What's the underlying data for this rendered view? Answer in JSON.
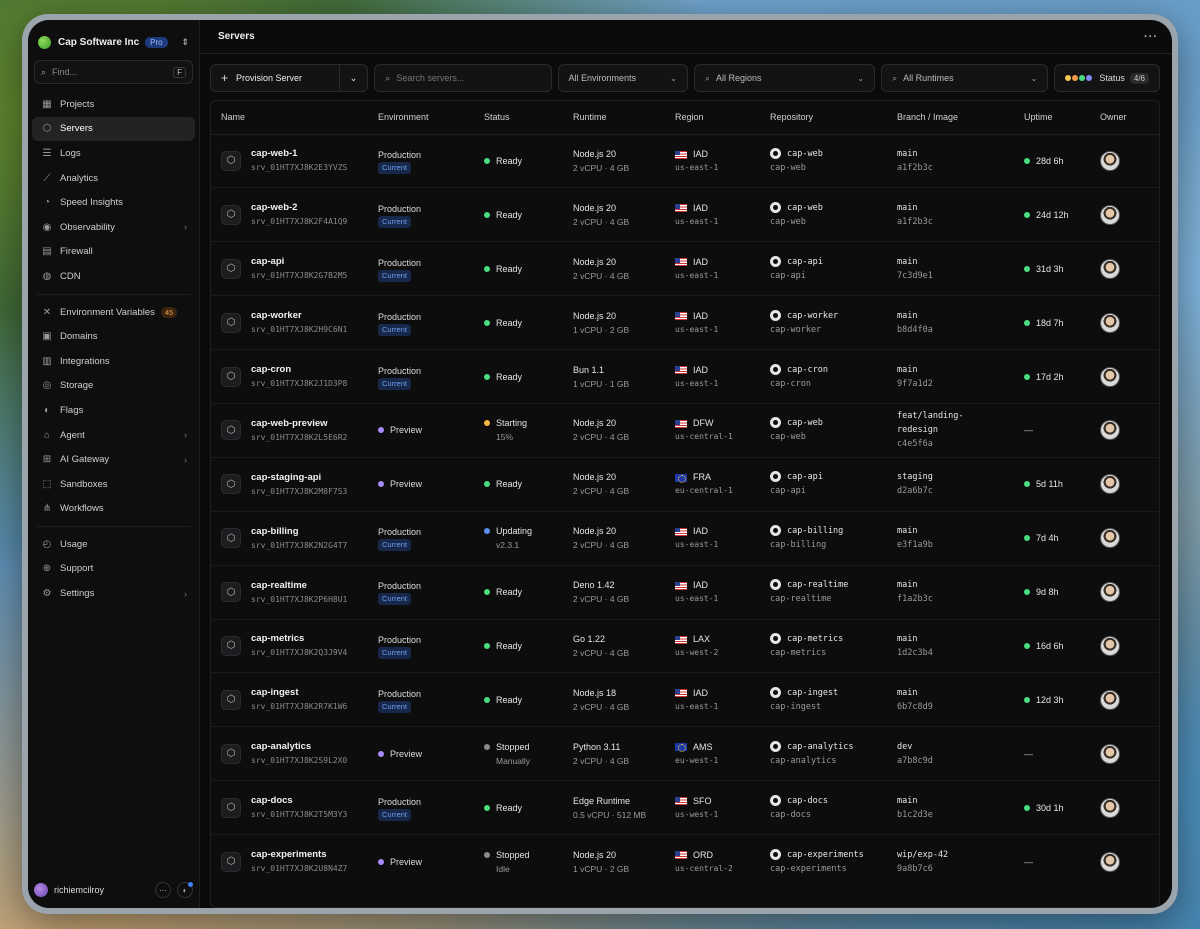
{
  "team": {
    "name": "Cap Software Inc",
    "plan": "Pro"
  },
  "find": {
    "placeholder": "Find...",
    "shortcut": "F"
  },
  "nav": {
    "group1": [
      {
        "label": "Projects",
        "icon": "grid-icon"
      },
      {
        "label": "Servers",
        "icon": "cube-icon",
        "active": true
      },
      {
        "label": "Logs",
        "icon": "list-icon"
      },
      {
        "label": "Analytics",
        "icon": "chart-icon"
      },
      {
        "label": "Speed Insights",
        "icon": "gauge-icon"
      },
      {
        "label": "Observability",
        "icon": "eye-icon",
        "chevron": true
      },
      {
        "label": "Firewall",
        "icon": "firewall-icon"
      },
      {
        "label": "CDN",
        "icon": "globe-icon"
      }
    ],
    "group2": [
      {
        "label": "Environment Variables",
        "icon": "variable-icon",
        "badge": "45"
      },
      {
        "label": "Domains",
        "icon": "domain-icon"
      },
      {
        "label": "Integrations",
        "icon": "integrations-icon"
      },
      {
        "label": "Storage",
        "icon": "database-icon"
      },
      {
        "label": "Flags",
        "icon": "flag-icon"
      },
      {
        "label": "Agent",
        "icon": "agent-icon",
        "chevron": true
      },
      {
        "label": "AI Gateway",
        "icon": "gateway-icon",
        "chevron": true
      },
      {
        "label": "Sandboxes",
        "icon": "sandbox-icon"
      },
      {
        "label": "Workflows",
        "icon": "workflow-icon"
      }
    ],
    "group3": [
      {
        "label": "Usage",
        "icon": "usage-icon"
      },
      {
        "label": "Support",
        "icon": "support-icon"
      },
      {
        "label": "Settings",
        "icon": "gear-icon",
        "chevron": true
      }
    ]
  },
  "user": {
    "name": "richiemcilroy"
  },
  "page": {
    "title": "Servers"
  },
  "toolbar": {
    "provision": "Provision Server",
    "search_placeholder": "Search servers...",
    "environments": "All Environments",
    "regions": "All Regions",
    "runtimes": "All Runtimes",
    "status": "Status",
    "status_count": "4/6",
    "status_colors": [
      "#f2c94c",
      "#f2994a",
      "#4ade80",
      "#818cf8"
    ]
  },
  "table": {
    "columns": [
      "Name",
      "Environment",
      "Status",
      "Runtime",
      "Region",
      "Repository",
      "Branch / Image",
      "Uptime",
      "Owner"
    ],
    "rows": [
      {
        "name": "cap-web-1",
        "id": "srv_01HT7XJ8K2E3YVZS",
        "env": "Production",
        "current": true,
        "status": "Ready",
        "status_sub": "",
        "status_color": "#4ade80",
        "runtime": "Node.js 20",
        "spec": "2 vCPU · 4 GB",
        "flag": "us",
        "region": "IAD",
        "region_sub": "us-east-1",
        "repo": "cap-web",
        "repo_sub": "cap-web",
        "branch": "main",
        "commit": "a1f2b3c",
        "uptime": "28d 6h"
      },
      {
        "name": "cap-web-2",
        "id": "srv_01HT7XJ8K2F4A1Q9",
        "env": "Production",
        "current": true,
        "status": "Ready",
        "status_sub": "",
        "status_color": "#4ade80",
        "runtime": "Node.js 20",
        "spec": "2 vCPU · 4 GB",
        "flag": "us",
        "region": "IAD",
        "region_sub": "us-east-1",
        "repo": "cap-web",
        "repo_sub": "cap-web",
        "branch": "main",
        "commit": "a1f2b3c",
        "uptime": "24d 12h"
      },
      {
        "name": "cap-api",
        "id": "srv_01HT7XJ8K2G7B2M5",
        "env": "Production",
        "current": true,
        "status": "Ready",
        "status_sub": "",
        "status_color": "#4ade80",
        "runtime": "Node.js 20",
        "spec": "2 vCPU · 4 GB",
        "flag": "us",
        "region": "IAD",
        "region_sub": "us-east-1",
        "repo": "cap-api",
        "repo_sub": "cap-api",
        "branch": "main",
        "commit": "7c3d9e1",
        "uptime": "31d 3h"
      },
      {
        "name": "cap-worker",
        "id": "srv_01HT7XJ8K2H9C6N1",
        "env": "Production",
        "current": true,
        "status": "Ready",
        "status_sub": "",
        "status_color": "#4ade80",
        "runtime": "Node.js 20",
        "spec": "1 vCPU · 2 GB",
        "flag": "us",
        "region": "IAD",
        "region_sub": "us-east-1",
        "repo": "cap-worker",
        "repo_sub": "cap-worker",
        "branch": "main",
        "commit": "b8d4f0a",
        "uptime": "18d 7h"
      },
      {
        "name": "cap-cron",
        "id": "srv_01HT7XJ8K2J1D3P8",
        "env": "Production",
        "current": true,
        "status": "Ready",
        "status_sub": "",
        "status_color": "#4ade80",
        "runtime": "Bun 1.1",
        "spec": "1 vCPU · 1 GB",
        "flag": "us",
        "region": "IAD",
        "region_sub": "us-east-1",
        "repo": "cap-cron",
        "repo_sub": "cap-cron",
        "branch": "main",
        "commit": "9f7a1d2",
        "uptime": "17d 2h"
      },
      {
        "name": "cap-web-preview",
        "id": "srv_01HT7XJ8K2L5E6R2",
        "env": "Preview",
        "current": false,
        "status": "Starting",
        "status_sub": "15%",
        "status_color": "#f5b841",
        "runtime": "Node.js 20",
        "spec": "2 vCPU · 4 GB",
        "flag": "us",
        "region": "DFW",
        "region_sub": "us-central-1",
        "repo": "cap-web",
        "repo_sub": "cap-web",
        "branch": "feat/landing-redesign",
        "commit": "c4e5f6a",
        "uptime": "—"
      },
      {
        "name": "cap-staging-api",
        "id": "srv_01HT7XJ8K2M8F7S3",
        "env": "Preview",
        "current": false,
        "status": "Ready",
        "status_sub": "",
        "status_color": "#4ade80",
        "runtime": "Node.js 20",
        "spec": "2 vCPU · 4 GB",
        "flag": "eu",
        "region": "FRA",
        "region_sub": "eu-central-1",
        "repo": "cap-api",
        "repo_sub": "cap-api",
        "branch": "staging",
        "commit": "d2a6b7c",
        "uptime": "5d 11h"
      },
      {
        "name": "cap-billing",
        "id": "srv_01HT7XJ8K2N2G4T7",
        "env": "Production",
        "current": true,
        "status": "Updating",
        "status_sub": "v2.3.1",
        "status_color": "#5b8def",
        "runtime": "Node.js 20",
        "spec": "2 vCPU · 4 GB",
        "flag": "us",
        "region": "IAD",
        "region_sub": "us-east-1",
        "repo": "cap-billing",
        "repo_sub": "cap-billing",
        "branch": "main",
        "commit": "e3f1a9b",
        "uptime": "7d 4h"
      },
      {
        "name": "cap-realtime",
        "id": "srv_01HT7XJ8K2P6H8U1",
        "env": "Production",
        "current": true,
        "status": "Ready",
        "status_sub": "",
        "status_color": "#4ade80",
        "runtime": "Deno 1.42",
        "spec": "2 vCPU · 4 GB",
        "flag": "us",
        "region": "IAD",
        "region_sub": "us-east-1",
        "repo": "cap-realtime",
        "repo_sub": "cap-realtime",
        "branch": "main",
        "commit": "f1a2b3c",
        "uptime": "9d 8h"
      },
      {
        "name": "cap-metrics",
        "id": "srv_01HT7XJ8K2Q3J9V4",
        "env": "Production",
        "current": true,
        "status": "Ready",
        "status_sub": "",
        "status_color": "#4ade80",
        "runtime": "Go 1.22",
        "spec": "2 vCPU · 4 GB",
        "flag": "us",
        "region": "LAX",
        "region_sub": "us-west-2",
        "repo": "cap-metrics",
        "repo_sub": "cap-metrics",
        "branch": "main",
        "commit": "1d2c3b4",
        "uptime": "16d 6h"
      },
      {
        "name": "cap-ingest",
        "id": "srv_01HT7XJ8K2R7K1W6",
        "env": "Production",
        "current": true,
        "status": "Ready",
        "status_sub": "",
        "status_color": "#4ade80",
        "runtime": "Node.js 18",
        "spec": "2 vCPU · 4 GB",
        "flag": "us",
        "region": "IAD",
        "region_sub": "us-east-1",
        "repo": "cap-ingest",
        "repo_sub": "cap-ingest",
        "branch": "main",
        "commit": "6b7c8d9",
        "uptime": "12d 3h"
      },
      {
        "name": "cap-analytics",
        "id": "srv_01HT7XJ8K2S9L2X0",
        "env": "Preview",
        "current": false,
        "status": "Stopped",
        "status_sub": "Manually",
        "status_color": "#8a8a8a",
        "runtime": "Python 3.11",
        "spec": "2 vCPU · 4 GB",
        "flag": "eu",
        "region": "AMS",
        "region_sub": "eu-west-1",
        "repo": "cap-analytics",
        "repo_sub": "cap-analytics",
        "branch": "dev",
        "commit": "a7b8c9d",
        "uptime": "—"
      },
      {
        "name": "cap-docs",
        "id": "srv_01HT7XJ8K2T5M3Y3",
        "env": "Production",
        "current": true,
        "status": "Ready",
        "status_sub": "",
        "status_color": "#4ade80",
        "runtime": "Edge Runtime",
        "spec": "0.5 vCPU · 512 MB",
        "flag": "us",
        "region": "SFO",
        "region_sub": "us-west-1",
        "repo": "cap-docs",
        "repo_sub": "cap-docs",
        "branch": "main",
        "commit": "b1c2d3e",
        "uptime": "30d 1h"
      },
      {
        "name": "cap-experiments",
        "id": "srv_01HT7XJ8K2U8N4Z7",
        "env": "Preview",
        "current": false,
        "status": "Stopped",
        "status_sub": "Idle",
        "status_color": "#8a8a8a",
        "runtime": "Node.js 20",
        "spec": "1 vCPU · 2 GB",
        "flag": "us",
        "region": "ORD",
        "region_sub": "us-central-2",
        "repo": "cap-experiments",
        "repo_sub": "cap-experiments",
        "branch": "wip/exp-42",
        "commit": "9a8b7c6",
        "uptime": "—"
      }
    ],
    "current_label": "Current"
  },
  "colors": {
    "preview_dot": "#a78bfa",
    "ready": "#4ade80",
    "accent": "#3b82f6"
  }
}
